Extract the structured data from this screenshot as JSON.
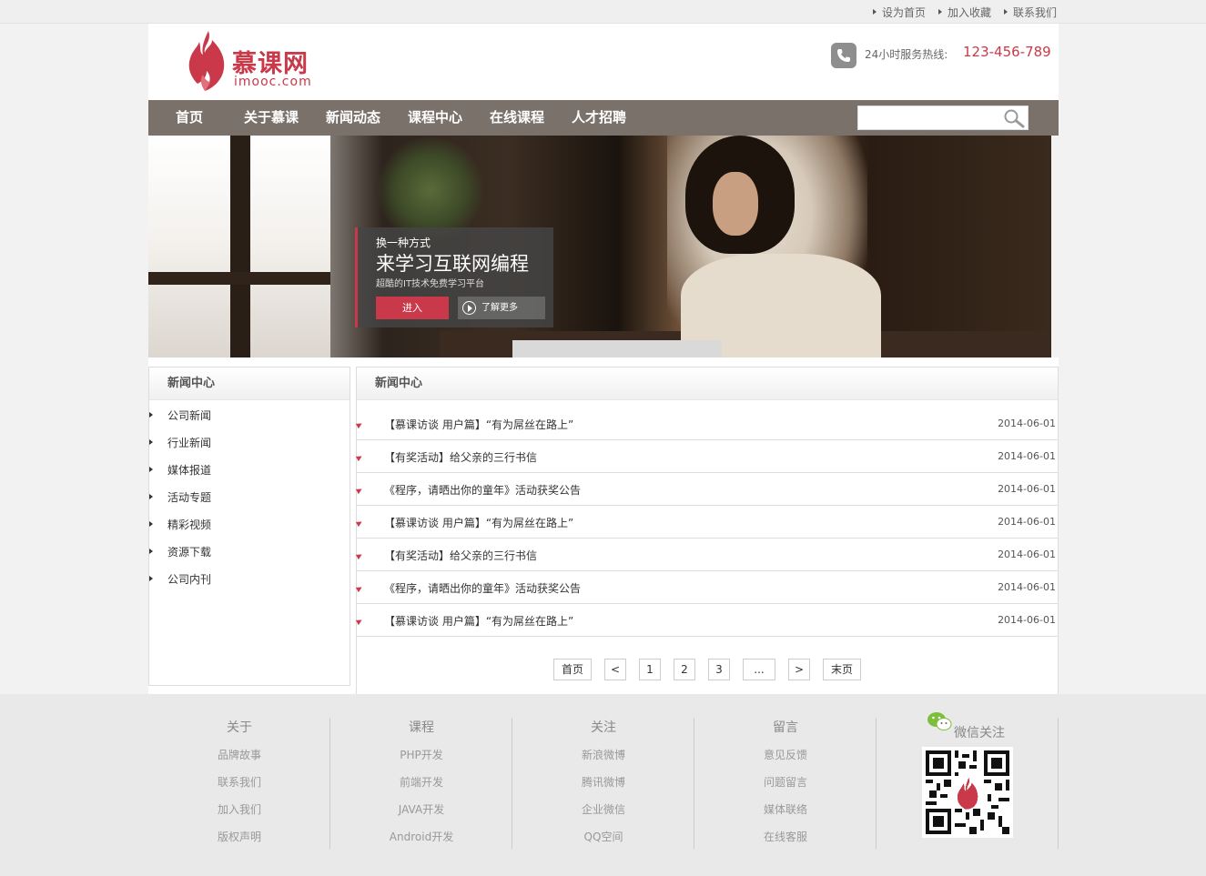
{
  "topbar": {
    "links": [
      "设为首页",
      "加入收藏",
      "联系我们"
    ]
  },
  "header": {
    "logo_cn": "慕课网",
    "logo_en": "imooc.com",
    "hotline_label": "24小时服务热线:",
    "hotline_number": "123-456-789"
  },
  "nav": {
    "items": [
      "首页",
      "关于慕课",
      "新闻动态",
      "课程中心",
      "在线课程",
      "人才招聘"
    ],
    "search_placeholder": ""
  },
  "banner": {
    "line1": "换一种方式",
    "line2": "来学习互联网编程",
    "line3": "超酷的IT技术免费学习平台",
    "enter_label": "进入",
    "more_label": "了解更多"
  },
  "sidebar": {
    "title": "新闻中心",
    "items": [
      "公司新闻",
      "行业新闻",
      "媒体报道",
      "活动专题",
      "精彩视频",
      "资源下载",
      "公司内刊"
    ]
  },
  "main": {
    "title": "新闻中心",
    "news": [
      {
        "title": "【慕课访谈 用户篇】“有为屌丝在路上”",
        "date": "2014-06-01"
      },
      {
        "title": "【有奖活动】给父亲的三行书信",
        "date": "2014-06-01"
      },
      {
        "title": "《程序，请晒出你的童年》活动获奖公告",
        "date": "2014-06-01"
      },
      {
        "title": "【慕课访谈 用户篇】“有为屌丝在路上”",
        "date": "2014-06-01"
      },
      {
        "title": "【有奖活动】给父亲的三行书信",
        "date": "2014-06-01"
      },
      {
        "title": "《程序，请晒出你的童年》活动获奖公告",
        "date": "2014-06-01"
      },
      {
        "title": "【慕课访谈 用户篇】“有为屌丝在路上”",
        "date": "2014-06-01"
      }
    ],
    "pager": {
      "first": "首页",
      "prev": "<",
      "pages": [
        "1",
        "2",
        "3"
      ],
      "ellipsis": "...",
      "next": ">",
      "last": "末页"
    }
  },
  "footer": {
    "columns": [
      {
        "title": "关于",
        "links": [
          "品牌故事",
          "联系我们",
          "加入我们",
          "版权声明"
        ]
      },
      {
        "title": "课程",
        "links": [
          "PHP开发",
          "前端开发",
          "JAVA开发",
          "Android开发"
        ]
      },
      {
        "title": "关注",
        "links": [
          "新浪微博",
          "腾讯微博",
          "企业微信",
          "QQ空间"
        ]
      },
      {
        "title": "留言",
        "links": [
          "意见反馈",
          "问题留言",
          "媒体联络",
          "在线客服"
        ]
      }
    ],
    "wechat_label": "微信关注"
  },
  "colors": {
    "brand_red": "#c9394a",
    "nav_bg": "#7a716a",
    "footer_bg": "#e9e9e9"
  },
  "icons": [
    "flame-logo-icon",
    "phone-icon",
    "search-icon",
    "play-icon",
    "wechat-icon",
    "qr-code"
  ]
}
